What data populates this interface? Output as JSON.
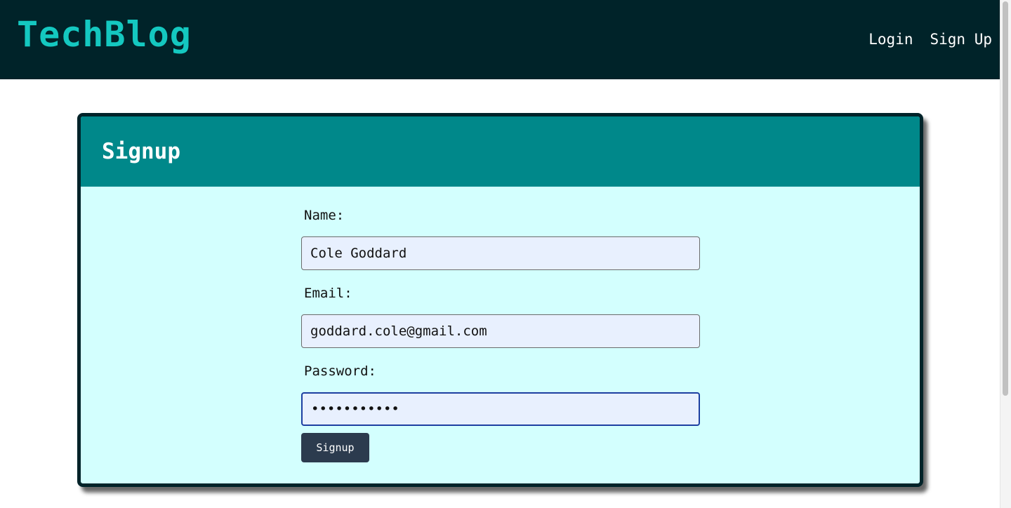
{
  "navbar": {
    "brand": "TechBlog",
    "links": [
      {
        "label": "Login"
      },
      {
        "label": "Sign Up"
      }
    ]
  },
  "card": {
    "title": "Signup",
    "fields": {
      "name": {
        "label": "Name:",
        "value": "Cole Goddard"
      },
      "email": {
        "label": "Email:",
        "value": "goddard.cole@gmail.com"
      },
      "password": {
        "label": "Password:",
        "value": "•••••••••••"
      }
    },
    "submit_label": "Signup"
  },
  "colors": {
    "navbar_bg": "#002329",
    "brand": "#14c8c0",
    "card_header": "#00888a",
    "card_body": "#d3fffe",
    "input_bg": "#e8f0fe",
    "button_bg": "#2c3b4e",
    "focus_border": "#1d3fa1"
  }
}
